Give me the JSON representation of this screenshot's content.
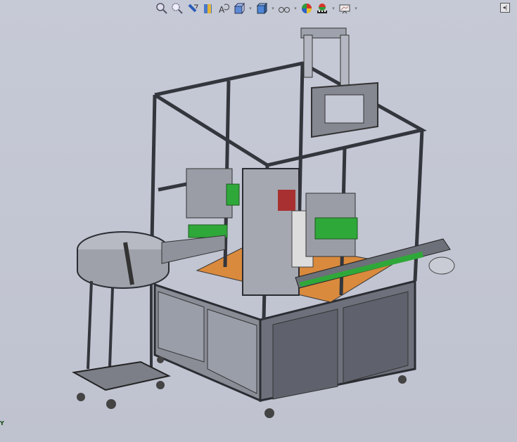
{
  "toolbar": {
    "items": [
      {
        "icon": "zoom-to-fit-icon",
        "dropdown": false
      },
      {
        "icon": "zoom-to-area-icon",
        "dropdown": false
      },
      {
        "icon": "previous-view-icon",
        "dropdown": false
      },
      {
        "icon": "section-view-icon",
        "dropdown": false
      },
      {
        "icon": "dynamic-annotation-icon",
        "dropdown": false
      },
      {
        "icon": "view-orientation-icon",
        "dropdown": true
      },
      {
        "icon": "display-style-icon",
        "dropdown": true
      },
      {
        "icon": "hide-show-items-icon",
        "dropdown": true
      },
      {
        "icon": "edit-appearance-icon",
        "dropdown": false
      },
      {
        "icon": "apply-scene-icon",
        "dropdown": true
      },
      {
        "icon": "view-settings-icon",
        "dropdown": true
      }
    ],
    "dropdown_glyph": "▾"
  },
  "corner_button_glyph": "◂|",
  "triad_label": "Y",
  "colors": {
    "background": "#c4c7d4",
    "frame": "#3a3d44",
    "panel": "#7d8089",
    "glass": "#9fa3ad",
    "orange_plate": "#d98a3d",
    "green_parts": "#2fa83a"
  }
}
